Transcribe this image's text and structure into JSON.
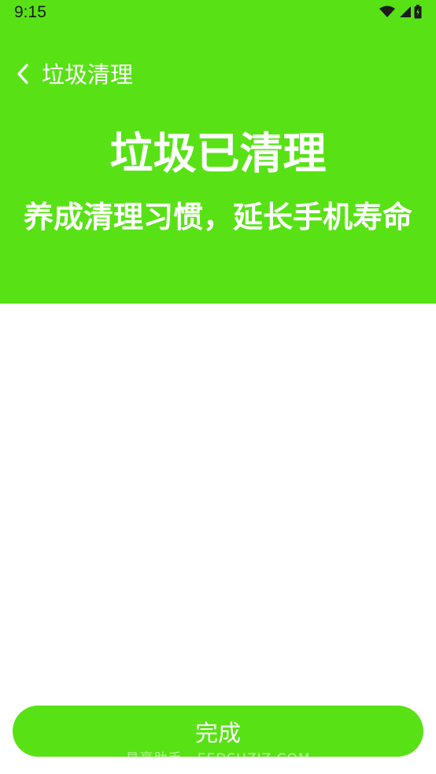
{
  "status_bar": {
    "time": "9:15"
  },
  "toolbar": {
    "back_icon": "chevron-left-icon",
    "title": "垃圾清理"
  },
  "result": {
    "headline": "垃圾已清理",
    "subline": "养成清理习惯，延长手机寿命"
  },
  "actions": {
    "done_label": "完成"
  },
  "watermark": {
    "text": "易豪助手 · EEDSHZIZ.COM"
  },
  "colors": {
    "accent": "#58e216",
    "background": "#ffffff",
    "text_on_accent": "#ffffff"
  }
}
